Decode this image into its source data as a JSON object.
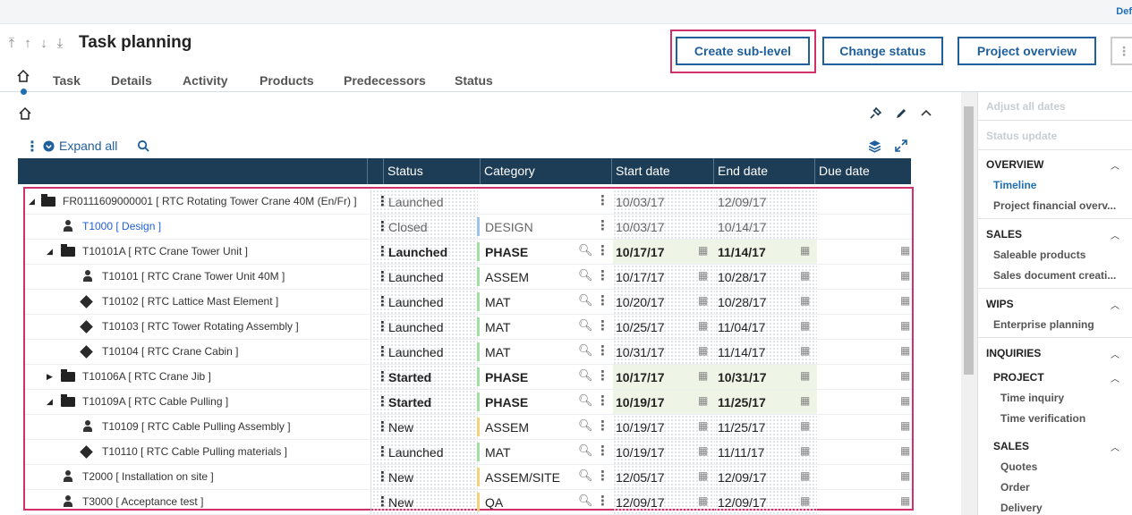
{
  "topbar": {
    "user_label": "Def"
  },
  "header": {
    "title": "Task planning"
  },
  "actions": {
    "create_sub_level": "Create sub-level",
    "change_status": "Change status",
    "project_overview": "Project overview",
    "more": "⋮"
  },
  "tabs": [
    "Task",
    "Details",
    "Activity",
    "Products",
    "Predecessors",
    "Status"
  ],
  "toolbar": {
    "expand_all": "Expand all"
  },
  "columns": {
    "status": "Status",
    "category": "Category",
    "start": "Start date",
    "end": "End date",
    "due": "Due date"
  },
  "rows": [
    {
      "name": "FR0111609000001 [ RTC Rotating Tower Crane 40M (En/Fr) ]",
      "status": "Launched",
      "category": "",
      "start": "10/03/17",
      "end": "12/09/17"
    },
    {
      "name": "T1000 [ Design ]",
      "status": "Closed",
      "category": "DESIGN",
      "start": "10/03/17",
      "end": "10/14/17"
    },
    {
      "name": "T10101A [ RTC Crane Tower Unit ]",
      "status": "Launched",
      "category": "PHASE",
      "start": "10/17/17",
      "end": "11/14/17"
    },
    {
      "name": "T10101 [ RTC Crane Tower Unit 40M ]",
      "status": "Launched",
      "category": "ASSEM",
      "start": "10/17/17",
      "end": "10/28/17"
    },
    {
      "name": "T10102 [ RTC Lattice Mast Element ]",
      "status": "Launched",
      "category": "MAT",
      "start": "10/20/17",
      "end": "10/28/17"
    },
    {
      "name": "T10103 [ RTC Tower Rotating Assembly ]",
      "status": "Launched",
      "category": "MAT",
      "start": "10/25/17",
      "end": "11/04/17"
    },
    {
      "name": "T10104 [ RTC Crane Cabin ]",
      "status": "Launched",
      "category": "MAT",
      "start": "10/31/17",
      "end": "11/14/17"
    },
    {
      "name": "T10106A [ RTC Crane Jib ]",
      "status": "Started",
      "category": "PHASE",
      "start": "10/17/17",
      "end": "10/31/17"
    },
    {
      "name": "T10109A [ RTC Cable Pulling ]",
      "status": "Started",
      "category": "PHASE",
      "start": "10/19/17",
      "end": "11/25/17"
    },
    {
      "name": "T10109 [ RTC Cable Pulling Assembly ]",
      "status": "New",
      "category": "ASSEM",
      "start": "10/19/17",
      "end": "11/25/17"
    },
    {
      "name": "T10110 [ RTC Cable Pulling materials ]",
      "status": "Launched",
      "category": "MAT",
      "start": "10/19/17",
      "end": "11/11/17"
    },
    {
      "name": "T2000 [ Installation on site ]",
      "status": "New",
      "category": "ASSEM/SITE",
      "start": "12/05/17",
      "end": "12/09/17"
    },
    {
      "name": "T3000 [ Acceptance test ]",
      "status": "New",
      "category": "QA",
      "start": "12/09/17",
      "end": "12/09/17"
    }
  ],
  "sidebar": {
    "adjust_all_dates": "Adjust all dates",
    "status_update": "Status update",
    "overview": "OVERVIEW",
    "timeline": "Timeline",
    "project_financial": "Project financial overv...",
    "sales": "SALES",
    "saleable_products": "Saleable products",
    "sales_document": "Sales document creati...",
    "wips": "WIPS",
    "enterprise_planning": "Enterprise planning",
    "inquiries": "INQUIRIES",
    "project": "PROJECT",
    "time_inquiry": "Time inquiry",
    "time_verification": "Time verification",
    "sales2": "SALES",
    "quotes": "Quotes",
    "order": "Order",
    "delivery": "Delivery"
  },
  "colors": {
    "accent": "#1f5f9c",
    "highlight": "#d1306a",
    "header_bg": "#1d3c55"
  }
}
